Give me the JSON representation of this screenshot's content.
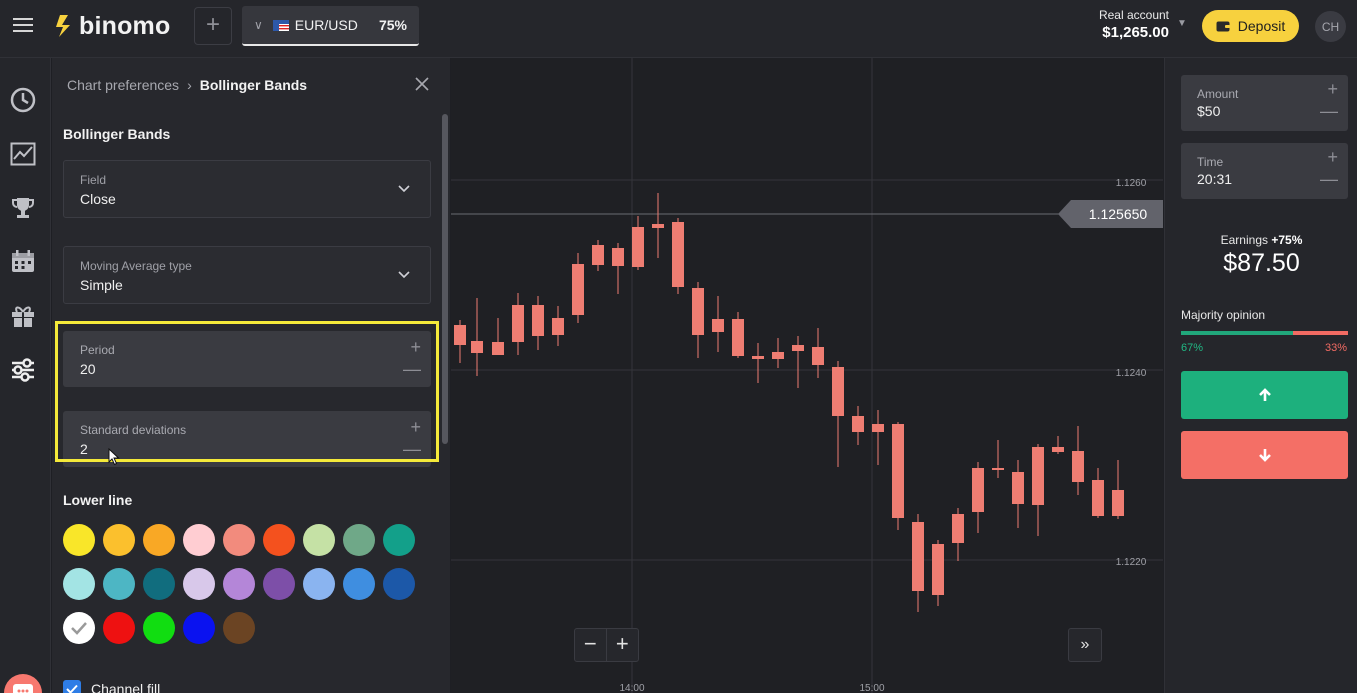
{
  "header": {
    "brand": "binomo",
    "asset": {
      "name": "EUR/USD",
      "payout": "75%"
    },
    "account": {
      "label": "Real account",
      "balance": "$1,265.00"
    },
    "deposit_label": "Deposit",
    "avatar_initials": "CH"
  },
  "sidebar": {
    "items": [
      {
        "icon": "clock-icon"
      },
      {
        "icon": "chart-icon"
      },
      {
        "icon": "trophy-icon"
      },
      {
        "icon": "calendar-icon"
      },
      {
        "icon": "gift-icon"
      },
      {
        "icon": "sliders-icon",
        "active": true
      }
    ]
  },
  "panel": {
    "breadcrumb_root": "Chart preferences",
    "breadcrumb_current": "Bollinger Bands",
    "section_title": "Bollinger Bands",
    "field": {
      "label": "Field",
      "value": "Close"
    },
    "ma_type": {
      "label": "Moving Average type",
      "value": "Simple"
    },
    "period": {
      "label": "Period",
      "value": "20"
    },
    "std_dev": {
      "label": "Standard deviations",
      "value": "2"
    },
    "lower_line_title": "Lower line",
    "palette": [
      "#f9e629",
      "#fbc02d",
      "#f9a825",
      "#ffcdd2",
      "#f28b7d",
      "#f4511e",
      "#c5e1a5",
      "#6fa888",
      "#13a08a",
      "#a3e4e4",
      "#4db6c4",
      "#116d7e",
      "#d8c8ea",
      "#b486d8",
      "#7d4fa8",
      "#8ab4f0",
      "#3f8ee0",
      "#1c58a8",
      "#ffffff",
      "#ee1111",
      "#11dd11",
      "#0a12f0",
      "#6b4423"
    ],
    "selected_color_index": 18,
    "channel_fill_label": "Channel fill"
  },
  "chart": {
    "price_tag": "1.125650",
    "y_ticks": [
      "1.1260",
      "1.1240",
      "1.1220"
    ],
    "x_ticks": [
      "14:00",
      "15:00"
    ]
  },
  "trade": {
    "amount": {
      "label": "Amount",
      "value": "$50"
    },
    "time": {
      "label": "Time",
      "value": "20:31"
    },
    "earnings_label": "Earnings",
    "earnings_pct": "+75%",
    "earnings_value": "$87.50",
    "majority_label": "Majority opinion",
    "majority_up": "67%",
    "majority_down": "33%",
    "majority_up_fraction": 0.67,
    "up_color": "#1db07d",
    "down_color": "#f46f66"
  }
}
